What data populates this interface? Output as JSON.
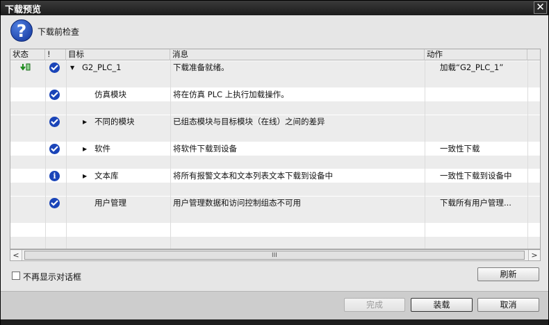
{
  "window": {
    "title": "下载预览"
  },
  "header": {
    "title": "下载前检查",
    "icon": "question-icon"
  },
  "table": {
    "columns": [
      "状态",
      "!",
      "目标",
      "消息",
      "动作"
    ],
    "rows": [
      {
        "status_icon": "download-status-icon",
        "check": "check",
        "expander": "expanded",
        "target": "G2_PLC_1",
        "message": "下载准备就绪。",
        "action": "加载“G2_PLC_1”"
      },
      {
        "status_icon": "",
        "check": "check",
        "expander": "none",
        "target": "仿真模块",
        "message": "将在仿真 PLC 上执行加载操作。",
        "action": ""
      },
      {
        "status_icon": "",
        "check": "check",
        "expander": "collapsed",
        "target": "不同的模块",
        "message": "已组态模块与目标模块（在线）之间的差异",
        "action": ""
      },
      {
        "status_icon": "",
        "check": "check",
        "expander": "collapsed",
        "target": "软件",
        "message": "将软件下载到设备",
        "action": "一致性下载"
      },
      {
        "status_icon": "",
        "check": "info",
        "expander": "collapsed",
        "target": "文本库",
        "message": "将所有报警文本和文本列表文本下载到设备中",
        "action": "一致性下载到设备中"
      },
      {
        "status_icon": "",
        "check": "check",
        "expander": "none",
        "target": "用户管理",
        "message": "用户管理数据和访问控制组态不可用",
        "action": "下载所有用户管理..."
      }
    ]
  },
  "scrollbar": {
    "left": "<",
    "right": ">",
    "grip": "III"
  },
  "dont_show": {
    "label": "不再显示对话框",
    "checked": false
  },
  "buttons": {
    "refresh": "刷新",
    "finish": "完成",
    "load": "装载",
    "cancel": "取消"
  },
  "colors": {
    "accent": "#1a44b8",
    "titlebar": "#2a2a2a"
  }
}
